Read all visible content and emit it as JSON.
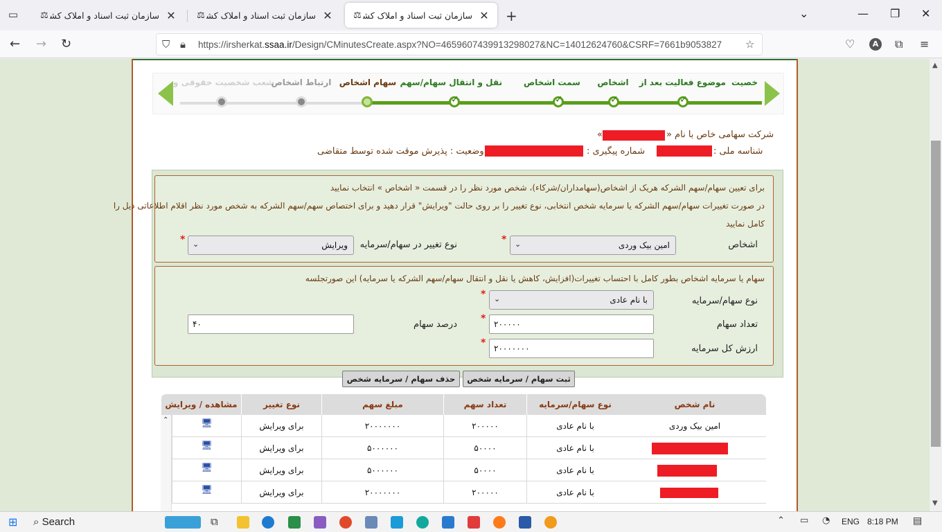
{
  "browser": {
    "tabs": [
      {
        "title": "سازمان ثبت اسناد و املاک کشور",
        "active": false
      },
      {
        "title": "سازمان ثبت اسناد و املاک کشور",
        "active": false
      },
      {
        "title": "سازمان ثبت اسناد و املاک کشور",
        "active": true
      }
    ],
    "url_prefix": "https://irsherkat.",
    "url_domain": "ssaa.ir",
    "url_rest": "/Design/CMinutesCreate.aspx?NO=4659607439913298027&NC=14012624760&CSRF=7661b9053827",
    "avatar_letter": "A",
    "icons": {
      "tab_list": "tab-list-icon",
      "new_tab": "plus-icon",
      "back": "back-arrow-icon",
      "forward": "forward-arrow-icon",
      "reload": "reload-icon",
      "shield": "shield-icon",
      "lock": "lock-icon",
      "bookmark": "star-icon",
      "pocket": "pocket-icon",
      "extensions": "puzzle-icon",
      "menu": "hamburger-icon"
    }
  },
  "wizard": {
    "steps": [
      {
        "label": "شعب شخصیت حقوقی و",
        "state": "faded"
      },
      {
        "label": "ارتباط اشخاص",
        "state": "future"
      },
      {
        "label": "سهام اشخاص",
        "state": "current"
      },
      {
        "label": "نقل و انتقال سهام/سهم الشرکه",
        "state": "done"
      },
      {
        "label": "سمت اشخاص",
        "state": "done"
      },
      {
        "label": "اشخاص",
        "state": "done"
      },
      {
        "label": "موضوع فعالیت بعد از الحاق",
        "state": "done"
      },
      {
        "label": "خصیت",
        "state": "done"
      }
    ]
  },
  "company": {
    "title_prefix": "شرکت سهامی خاص با نام «",
    "title_suffix": "»",
    "national_id_label": "شناسه ملی :",
    "tracking_label": "شماره پیگیری :",
    "status_label": "وضعیت : پذیرش موقت شده توسط متقاضی"
  },
  "form1": {
    "instruction1": "برای تعیین سهام/سهم الشرکه هریک از اشخاص(سهامداران/شرکاء)، شخص مورد نظر را در قسمت « اشخاص » انتخاب نمایید",
    "instruction2": "در صورت تغییرات سهام/سهم الشرکه یا سرمایه شخص انتخابی، نوع تغییر را بر روی حالت \"ویرایش\" قرار دهید و برای اختصاص سهم/سهم الشرکه به شخص مورد نظر اقلام اطلاعاتی ذیل را",
    "instruction3": "کامل نمایید",
    "person_label": "اشخاص",
    "person_value": "امین بیک وردی",
    "change_type_label": "نوع تغییر در سهام/سرمایه",
    "change_type_value": "ویرایش"
  },
  "form2": {
    "note": "سهام یا سرمایه اشخاص بطور کامل با احتساب تغییرات(افزایش، کاهش یا نقل و انتقال سهام/سهم الشرکه یا سرمایه) این صورتجلسه",
    "share_type_label": "نوع سهام/سرمایه",
    "share_type_value": "با نام عادی",
    "share_count_label": "تعداد سهام",
    "share_count_value": "۲۰۰۰۰۰",
    "share_percent_label": "درصد سهام",
    "share_percent_value": "۴۰",
    "total_capital_label": "ارزش کل سرمایه",
    "total_capital_value": "۲۰۰۰۰۰۰۰"
  },
  "buttons": {
    "register": "ثبت سهام / سرمایه شخص",
    "delete": "حذف سهام / سرمایه شخص"
  },
  "table": {
    "headers": [
      "نام شخص",
      "نوع سهام/سرمایه",
      "تعداد سهم",
      "مبلغ سهم",
      "نوع تغییر",
      "مشاهده / ویرایش"
    ],
    "rows": [
      {
        "name": "امین بیک وردی",
        "type": "با نام عادی",
        "count": "۲۰۰۰۰۰",
        "amount": "۲۰۰۰۰۰۰۰",
        "change": "برای ویرایش",
        "edit_icon": "computer-edit-icon"
      },
      {
        "name": "",
        "type": "با نام عادی",
        "count": "۵۰۰۰۰",
        "amount": "۵۰۰۰۰۰۰",
        "change": "برای ویرایش",
        "edit_icon": "computer-edit-icon"
      },
      {
        "name": "",
        "type": "با نام عادی",
        "count": "۵۰۰۰۰",
        "amount": "۵۰۰۰۰۰۰",
        "change": "برای ویرایش",
        "edit_icon": "computer-edit-icon"
      },
      {
        "name": "",
        "type": "با نام عادی",
        "count": "۲۰۰۰۰۰",
        "amount": "۲۰۰۰۰۰۰۰",
        "change": "برای ویرایش",
        "edit_icon": "computer-edit-icon"
      }
    ]
  },
  "taskbar": {
    "search_label": "Search",
    "language": "ENG",
    "time": "8:18 PM"
  },
  "colors": {
    "accent_green": "#5a9e1a",
    "label_brown": "#6b3a12",
    "redaction": "#ee1c25",
    "page_bg": "#dfe9d5"
  }
}
